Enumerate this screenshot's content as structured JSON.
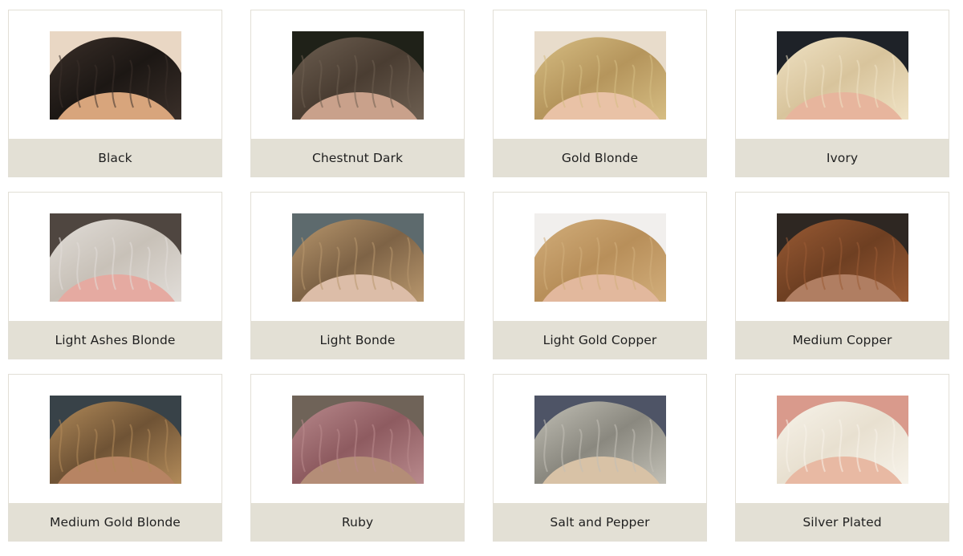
{
  "swatches": [
    {
      "label": "Black",
      "bg": "#e9d7c4",
      "hair": "#1c1714",
      "hair2": "#3a2f29",
      "skin": "#d8a57c"
    },
    {
      "label": "Chestnut Dark",
      "bg": "#1f2118",
      "hair": "#4a3d32",
      "hair2": "#6d5f51",
      "skin": "#c9a18b"
    },
    {
      "label": "Gold Blonde",
      "bg": "#e8dccb",
      "hair": "#b5955c",
      "hair2": "#d6bd83",
      "skin": "#e9c2a6"
    },
    {
      "label": "Ivory",
      "bg": "#1e2228",
      "hair": "#d8c49c",
      "hair2": "#efe2c4",
      "skin": "#e7b59d"
    },
    {
      "label": "Light Ashes Blonde",
      "bg": "#4f4640",
      "hair": "#c8c1b8",
      "hair2": "#e1ddd8",
      "skin": "#e5aaa1"
    },
    {
      "label": "Light Bonde",
      "bg": "#5d6a6d",
      "hair": "#7e6346",
      "hair2": "#b8976d",
      "skin": "#dcbda8"
    },
    {
      "label": "Light Gold Copper",
      "bg": "#f1efed",
      "hair": "#b88f5a",
      "hair2": "#d2ae7b",
      "skin": "#e2b89d"
    },
    {
      "label": "Medium Copper",
      "bg": "#2e2722",
      "hair": "#6e3f22",
      "hair2": "#9a5b34",
      "skin": "#b07e62"
    },
    {
      "label": "Medium Gold Blonde",
      "bg": "#384248",
      "hair": "#6f5335",
      "hair2": "#b28b5a",
      "skin": "#b78463"
    },
    {
      "label": "Ruby",
      "bg": "#6f6358",
      "hair": "#8e5b60",
      "hair2": "#b98a8d",
      "skin": "#b48d77"
    },
    {
      "label": "Salt and Pepper",
      "bg": "#4e5466",
      "hair": "#8a887f",
      "hair2": "#c2c0b6",
      "skin": "#d8c2a6"
    },
    {
      "label": "Silver Plated",
      "bg": "#d99a8c",
      "hair": "#e8e0d0",
      "hair2": "#f7f3ea",
      "skin": "#e8b9a3"
    }
  ]
}
